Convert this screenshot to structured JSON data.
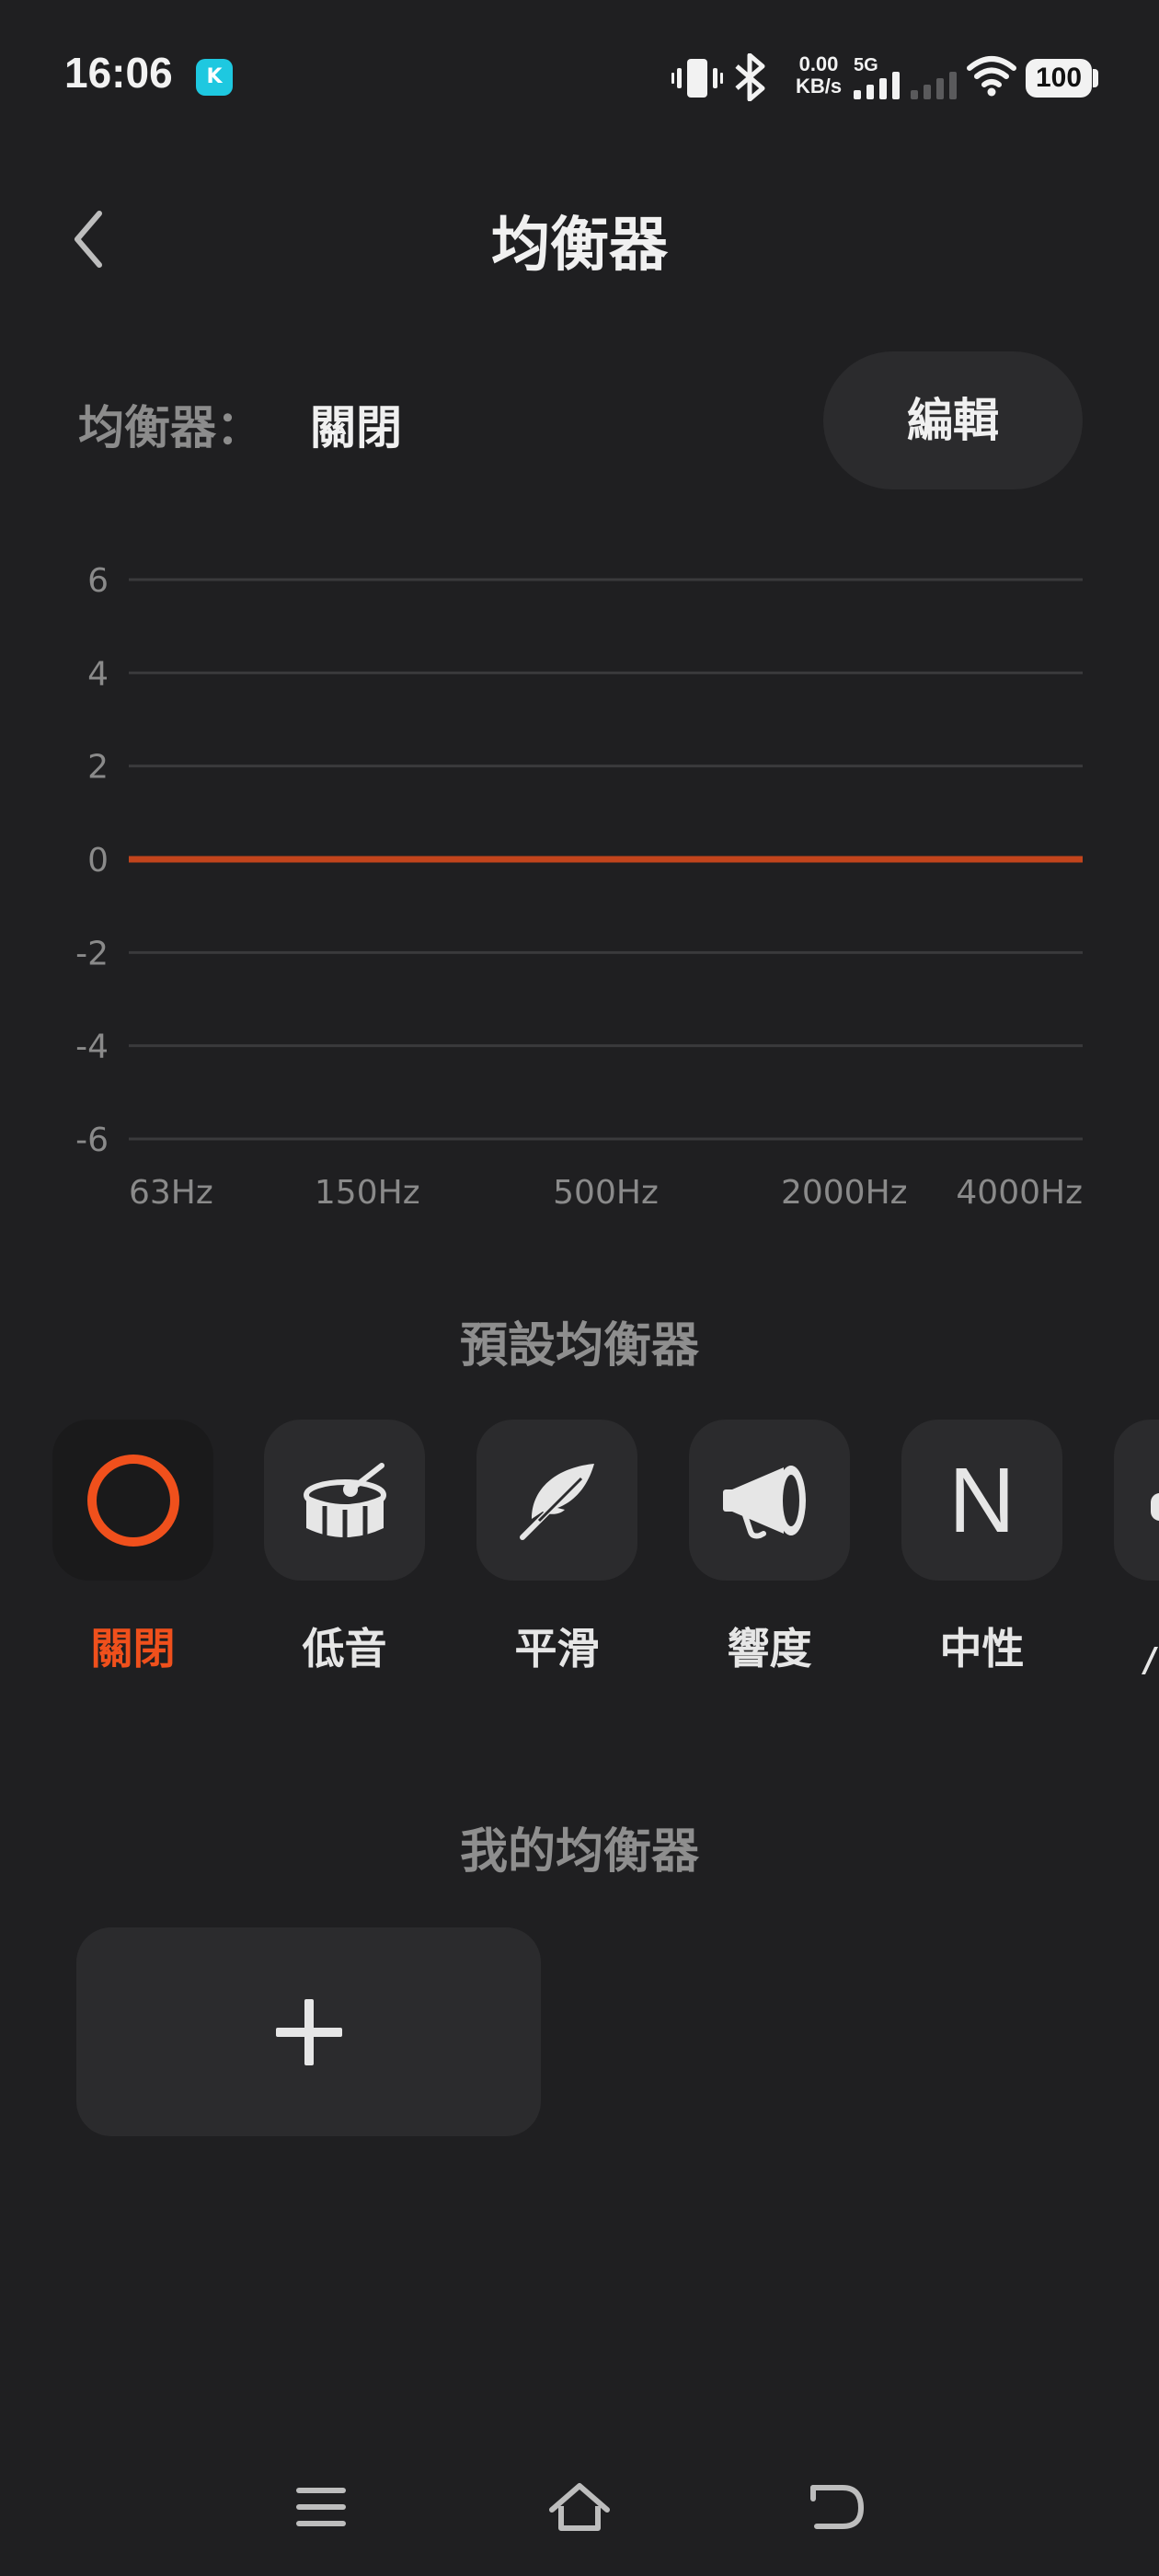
{
  "status": {
    "time": "16:06",
    "notification_icon": "k-app-icon",
    "net_speed_value": "0.00",
    "net_speed_unit": "KB/s",
    "network_type": "5G",
    "battery": "100"
  },
  "header": {
    "title": "均衡器"
  },
  "eq_status": {
    "label": "均衡器：",
    "state": "關閉",
    "edit_label": "編輯"
  },
  "chart_data": {
    "type": "line",
    "title": "",
    "xlabel": "",
    "ylabel": "",
    "ylim": [
      -6,
      6
    ],
    "y_ticks": [
      "6",
      "4",
      "2",
      "0",
      "-2",
      "-4",
      "-6"
    ],
    "x_ticks": [
      "63Hz",
      "150Hz",
      "500Hz",
      "2000Hz",
      "4000Hz"
    ],
    "grid": true,
    "series": [
      {
        "color": "#c2441c",
        "x": [
          "63Hz",
          "4000Hz"
        ],
        "values": [
          0,
          0
        ]
      }
    ]
  },
  "presets": {
    "title": "預設均衡器",
    "items": [
      {
        "label": "關閉",
        "icon": "ring-icon",
        "active": true
      },
      {
        "label": "低音",
        "icon": "drum-icon",
        "active": false
      },
      {
        "label": "平滑",
        "icon": "feather-icon",
        "active": false
      },
      {
        "label": "響度",
        "icon": "megaphone-icon",
        "active": false
      },
      {
        "label": "中性",
        "icon": "n-letter-icon",
        "glyph": "N",
        "active": false
      }
    ]
  },
  "my_eq": {
    "title": "我的均衡器",
    "add_icon": "plus-icon"
  },
  "colors": {
    "accent": "#f0501c",
    "background": "#1f1f21",
    "tile": "#2b2b2d",
    "line": "#c2441c"
  }
}
